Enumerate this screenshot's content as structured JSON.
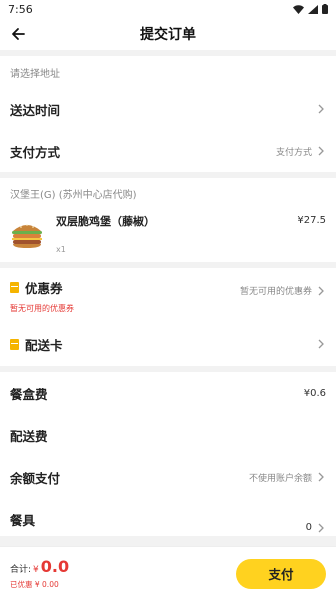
{
  "status": {
    "time": "7:56"
  },
  "nav": {
    "title": "提交订单"
  },
  "address": {
    "placeholder": "请选择地址"
  },
  "delivery": {
    "label": "送达时间"
  },
  "payment": {
    "label": "支付方式",
    "value": "支付方式"
  },
  "shop": {
    "name": "汉堡王(G) (苏州中心店代购)"
  },
  "item": {
    "name": "双层脆鸡堡（藤椒）",
    "price": "¥27.5",
    "qty": "x1"
  },
  "coupon": {
    "label": "优惠券",
    "sub": "暂无可用的优惠券",
    "value": "暂无可用的优惠券"
  },
  "delivery_card": {
    "label": "配送卡"
  },
  "box_fee": {
    "label": "餐盒费",
    "value": "¥0.6"
  },
  "delivery_fee": {
    "label": "配送费"
  },
  "balance": {
    "label": "余额支付",
    "value": "不使用账户余额"
  },
  "tableware": {
    "label": "餐具",
    "value": "0"
  },
  "footer": {
    "total_label": "合计:",
    "currency": "¥",
    "total": "0.0",
    "discount": "已优惠 ¥ 0.00",
    "pay_label": "支付"
  },
  "colors": {
    "accent": "#ffd21f",
    "price_red": "#e53935",
    "coupon_icon": "#f5b400"
  }
}
